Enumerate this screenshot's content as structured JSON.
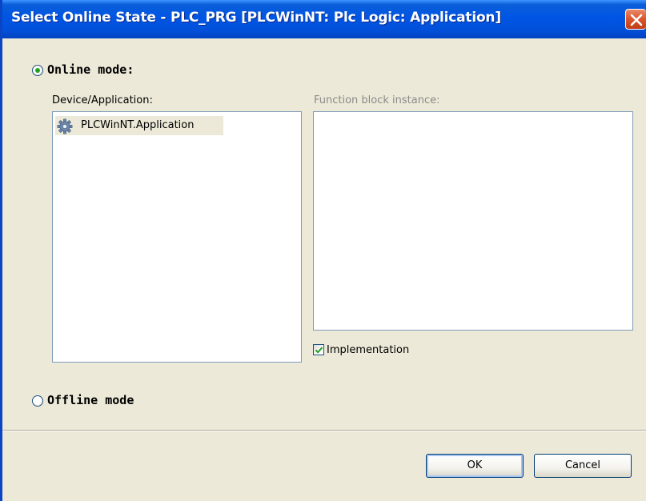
{
  "window": {
    "title": "Select Online State - PLC_PRG [PLCWinNT: Plc Logic: Application]"
  },
  "online_mode": {
    "label": "Online mode:",
    "selected": true
  },
  "device_application": {
    "label": "Device/Application:",
    "items": [
      {
        "label": "PLCWinNT.Application",
        "icon": "gear-icon",
        "selected": true
      }
    ]
  },
  "function_block_instance": {
    "label": "Function block instance:",
    "items": []
  },
  "implementation": {
    "label": "Implementation",
    "checked": true
  },
  "offline_mode": {
    "label": "Offline mode",
    "selected": false
  },
  "buttons": {
    "ok": "OK",
    "cancel": "Cancel"
  },
  "colors": {
    "titlebar": "#0055E5",
    "dialog_bg": "#ECE9D8",
    "close_button": "#D9552C",
    "list_border": "#7F9DB9",
    "radio_dot": "#21A121",
    "check_mark": "#21A121"
  }
}
